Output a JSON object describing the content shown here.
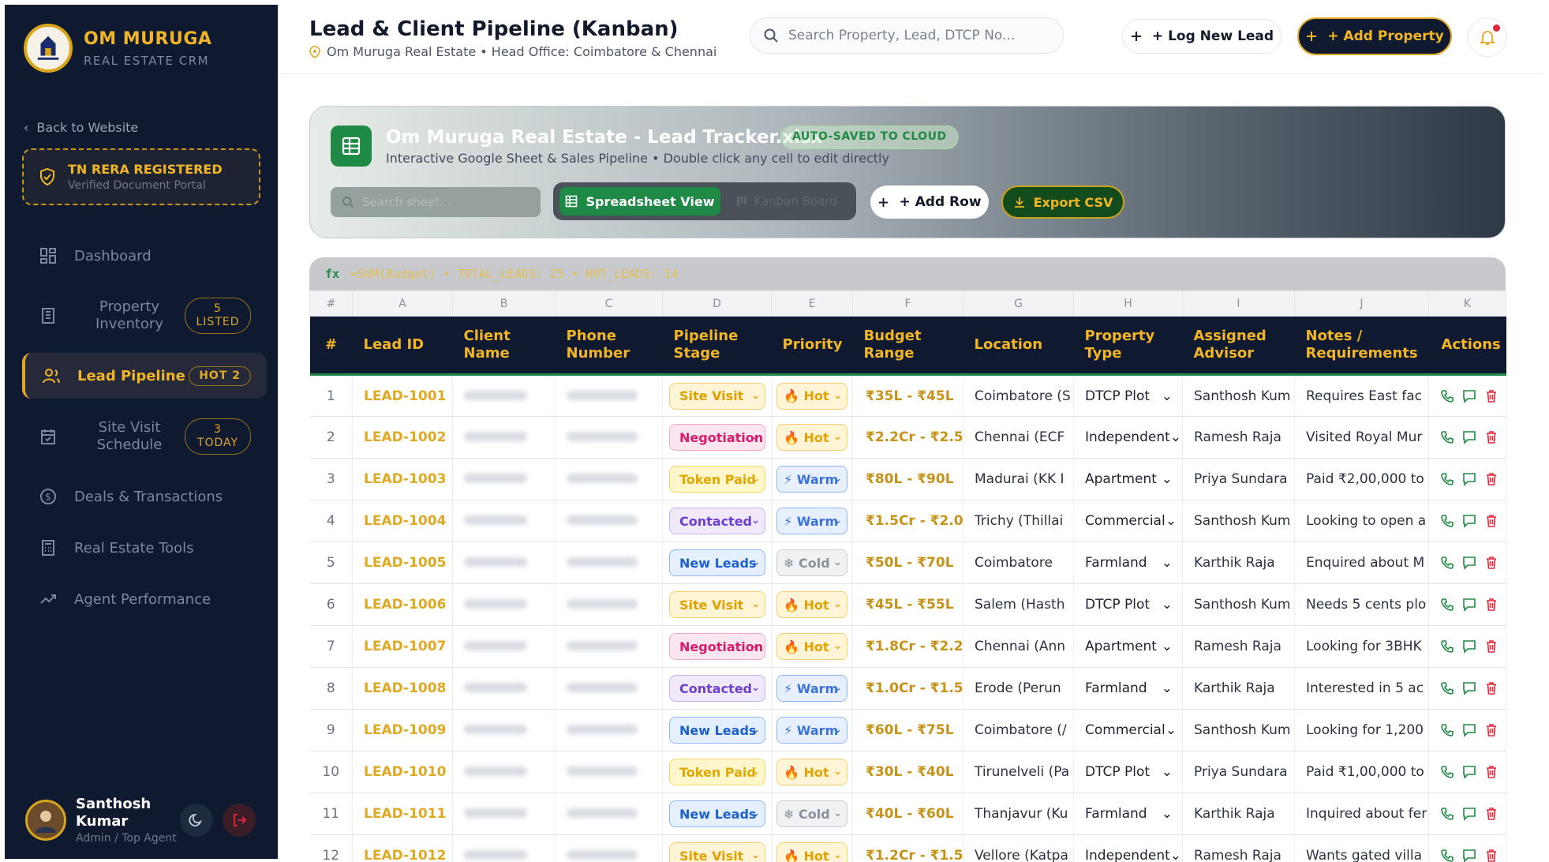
{
  "sidebar": {
    "brand_name": "OM MURUGA",
    "brand_sub": "REAL ESTATE CRM",
    "back_link": "Back to Website",
    "rera_title": "TN RERA REGISTERED",
    "rera_sub": "Verified Document Portal",
    "nav": {
      "dashboard": {
        "label": "Dashboard"
      },
      "inventory": {
        "label": "Property Inventory",
        "badge": "5 LISTED"
      },
      "pipeline": {
        "label": "Lead Pipeline",
        "badge": "HOT 2"
      },
      "sitevisit": {
        "label": "Site Visit Schedule",
        "badge": "3 TODAY"
      },
      "deals": {
        "label": "Deals & Transactions"
      },
      "tools": {
        "label": "Real Estate Tools"
      },
      "agents": {
        "label": "Agent Performance"
      }
    },
    "user": {
      "name": "Santhosh Kumar",
      "role": "Admin / Top Agent"
    }
  },
  "header": {
    "title": "Lead & Client Pipeline (Kanban)",
    "subtitle": "Om Muruga Real Estate • Head Office: Coimbatore & Chennai",
    "search_placeholder": "Search Property, Lead, DTCP No...",
    "log_lead": "+ Log New Lead",
    "add_property": "+ Add Property"
  },
  "sheet": {
    "title": "Om Muruga Real Estate - Lead Tracker.xlsx",
    "autosave": "AUTO-SAVED TO CLOUD",
    "subtitle": "Interactive Google Sheet & Sales Pipeline • Double click any cell to edit directly",
    "search_placeholder": "Search sheet...",
    "view_spreadsheet": "Spreadsheet View",
    "view_kanban": "Kanban Board",
    "add_row": "+ Add Row",
    "export": "Export CSV",
    "fx_label": "fx",
    "fx_text": "=SUM(Budget) • TOTAL_LEADS: 25 • HOT_LEADS: 14"
  },
  "grid": {
    "letters": [
      "#",
      "A",
      "B",
      "C",
      "D",
      "E",
      "F",
      "G",
      "H",
      "I",
      "J",
      "K"
    ],
    "headers": {
      "num": "#",
      "lead": "Lead ID",
      "client": "Client Name",
      "phone": "Phone Number",
      "stage": "Pipeline Stage",
      "priority": "Priority",
      "budget": "Budget Range",
      "location": "Location",
      "ptype": "Property Type",
      "advisor": "Assigned Advisor",
      "notes": "Notes / Requirements",
      "actions": "Actions"
    },
    "rows": [
      {
        "n": "1",
        "id": "LEAD-1001",
        "stage": "Site Visit",
        "prio": "🔥 Hot",
        "budget": "₹35L - ₹45L",
        "loc": "Coimbatore (S",
        "type": "DTCP Plot",
        "adv": "Santhosh Kum",
        "notes": "Requires East fac"
      },
      {
        "n": "2",
        "id": "LEAD-1002",
        "stage": "Negotiation",
        "prio": "🔥 Hot",
        "budget": "₹2.2Cr - ₹2.5",
        "loc": "Chennai (ECF",
        "type": "Independent",
        "adv": "Ramesh Raja",
        "notes": "Visited Royal Mur"
      },
      {
        "n": "3",
        "id": "LEAD-1003",
        "stage": "Token Paid",
        "prio": "⚡ Warm",
        "budget": "₹80L - ₹90L",
        "loc": "Madurai (KK I",
        "type": "Apartment",
        "adv": "Priya Sundara",
        "notes": "Paid ₹2,00,000 to"
      },
      {
        "n": "4",
        "id": "LEAD-1004",
        "stage": "Contacted",
        "prio": "⚡ Warm",
        "budget": "₹1.5Cr - ₹2.0",
        "loc": "Trichy (Thillai",
        "type": "Commercial",
        "adv": "Santhosh Kum",
        "notes": "Looking to open a"
      },
      {
        "n": "5",
        "id": "LEAD-1005",
        "stage": "New Leads",
        "prio": "❄ Cold",
        "budget": "₹50L - ₹70L",
        "loc": "Coimbatore",
        "type": "Farmland",
        "adv": "Karthik Raja",
        "notes": "Enquired about M"
      },
      {
        "n": "6",
        "id": "LEAD-1006",
        "stage": "Site Visit",
        "prio": "🔥 Hot",
        "budget": "₹45L - ₹55L",
        "loc": "Salem (Hasth",
        "type": "DTCP Plot",
        "adv": "Santhosh Kum",
        "notes": "Needs 5 cents plo"
      },
      {
        "n": "7",
        "id": "LEAD-1007",
        "stage": "Negotiation",
        "prio": "🔥 Hot",
        "budget": "₹1.8Cr - ₹2.2",
        "loc": "Chennai (Ann",
        "type": "Apartment",
        "adv": "Ramesh Raja",
        "notes": "Looking for 3BHK"
      },
      {
        "n": "8",
        "id": "LEAD-1008",
        "stage": "Contacted",
        "prio": "⚡ Warm",
        "budget": "₹1.0Cr - ₹1.5",
        "loc": "Erode (Perun",
        "type": "Farmland",
        "adv": "Karthik Raja",
        "notes": "Interested in 5 ac"
      },
      {
        "n": "9",
        "id": "LEAD-1009",
        "stage": "New Leads",
        "prio": "⚡ Warm",
        "budget": "₹60L - ₹75L",
        "loc": "Coimbatore (/",
        "type": "Commercial",
        "adv": "Santhosh Kum",
        "notes": "Looking for 1,200"
      },
      {
        "n": "10",
        "id": "LEAD-1010",
        "stage": "Token Paid",
        "prio": "🔥 Hot",
        "budget": "₹30L - ₹40L",
        "loc": "Tirunelveli (Pa",
        "type": "DTCP Plot",
        "adv": "Priya Sundara",
        "notes": "Paid ₹1,00,000 to"
      },
      {
        "n": "11",
        "id": "LEAD-1011",
        "stage": "New Leads",
        "prio": "❄ Cold",
        "budget": "₹40L - ₹60L",
        "loc": "Thanjavur (Ku",
        "type": "Farmland",
        "adv": "Karthik Raja",
        "notes": "Inquired about fer"
      },
      {
        "n": "12",
        "id": "LEAD-1012",
        "stage": "Site Visit",
        "prio": "🔥 Hot",
        "budget": "₹1.2Cr - ₹1.5",
        "loc": "Vellore (Katpa",
        "type": "Independent",
        "adv": "Ramesh Raja",
        "notes": "Wants gated villa"
      }
    ]
  },
  "colors": {
    "navy": "#0f1a31",
    "gold": "#f1b526",
    "green": "#1f8a45"
  }
}
